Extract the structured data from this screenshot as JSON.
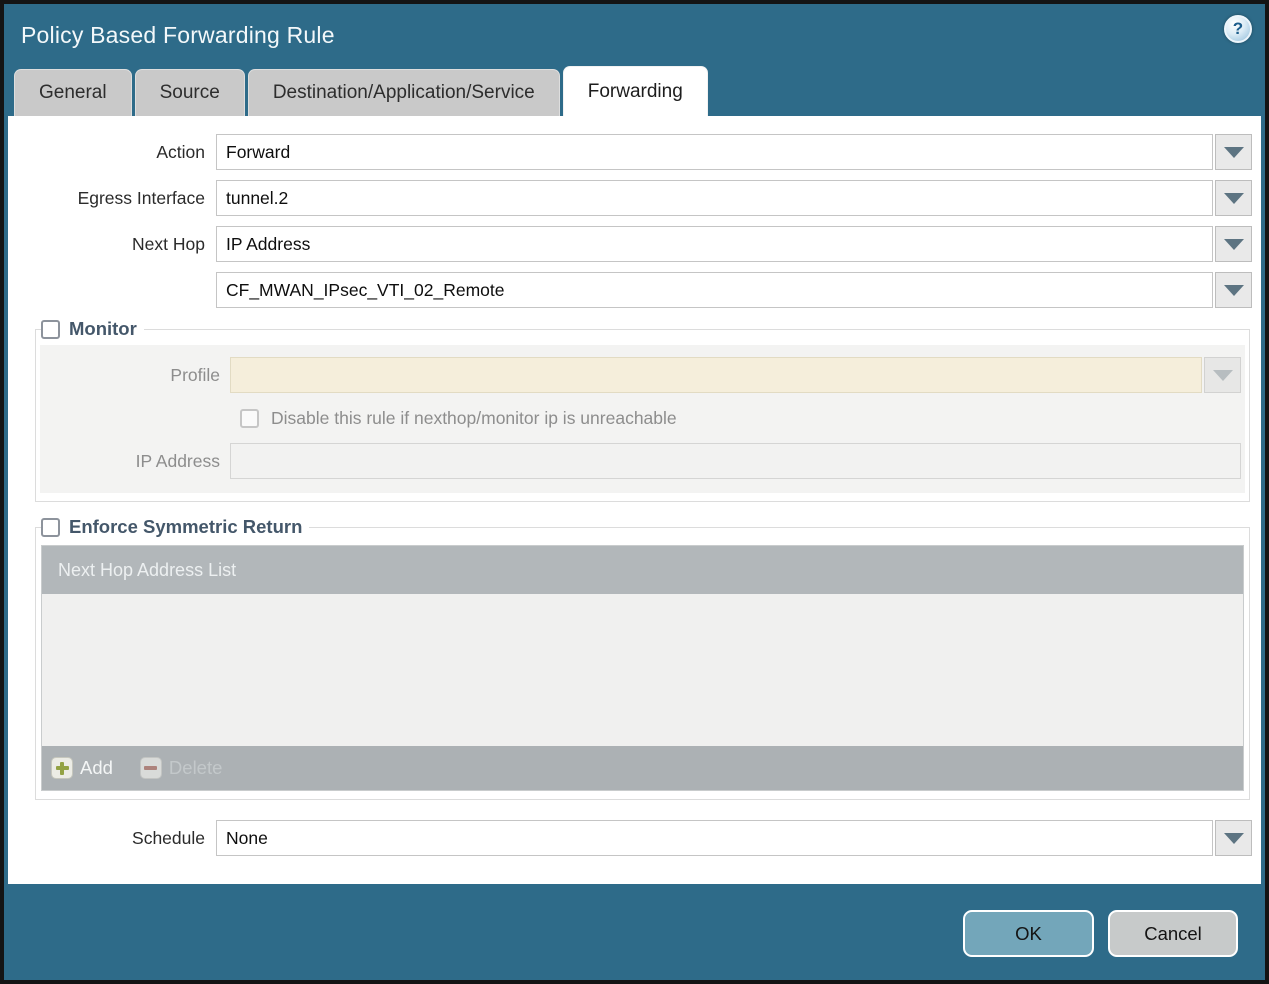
{
  "window": {
    "title": "Policy Based Forwarding Rule",
    "help_glyph": "?"
  },
  "tabs": [
    {
      "label": "General",
      "active": false
    },
    {
      "label": "Source",
      "active": false
    },
    {
      "label": "Destination/Application/Service",
      "active": false
    },
    {
      "label": "Forwarding",
      "active": true
    }
  ],
  "form": {
    "action": {
      "label": "Action",
      "value": "Forward"
    },
    "egress_interface": {
      "label": "Egress Interface",
      "value": "tunnel.2"
    },
    "next_hop": {
      "label": "Next Hop",
      "value": "IP Address"
    },
    "next_hop_address": {
      "value": "CF_MWAN_IPsec_VTI_02_Remote"
    },
    "schedule": {
      "label": "Schedule",
      "value": "None"
    }
  },
  "monitor": {
    "legend": "Monitor",
    "checked": false,
    "profile": {
      "label": "Profile",
      "value": ""
    },
    "disable_rule_label": "Disable this rule if nexthop/monitor ip is unreachable",
    "disable_rule_checked": false,
    "ip_address": {
      "label": "IP Address",
      "value": ""
    }
  },
  "symmetric_return": {
    "legend": "Enforce Symmetric Return",
    "checked": false,
    "table_header": "Next Hop Address List",
    "rows": [],
    "add_label": "Add",
    "delete_label": "Delete",
    "delete_enabled": false
  },
  "footer": {
    "ok_label": "OK",
    "cancel_label": "Cancel"
  },
  "colors": {
    "titlebar_background": "#2e6b89",
    "active_tab_background": "#ffffff",
    "inactive_tab_background": "#c9c9c9",
    "disabled_field_beige": "#f5eedb",
    "table_header_gray": "#b2b7ba",
    "ok_button": "#73a6ba",
    "cancel_button": "#c7caca",
    "add_plus_green": "#93a244",
    "delete_minus_red": "#ad837c"
  }
}
